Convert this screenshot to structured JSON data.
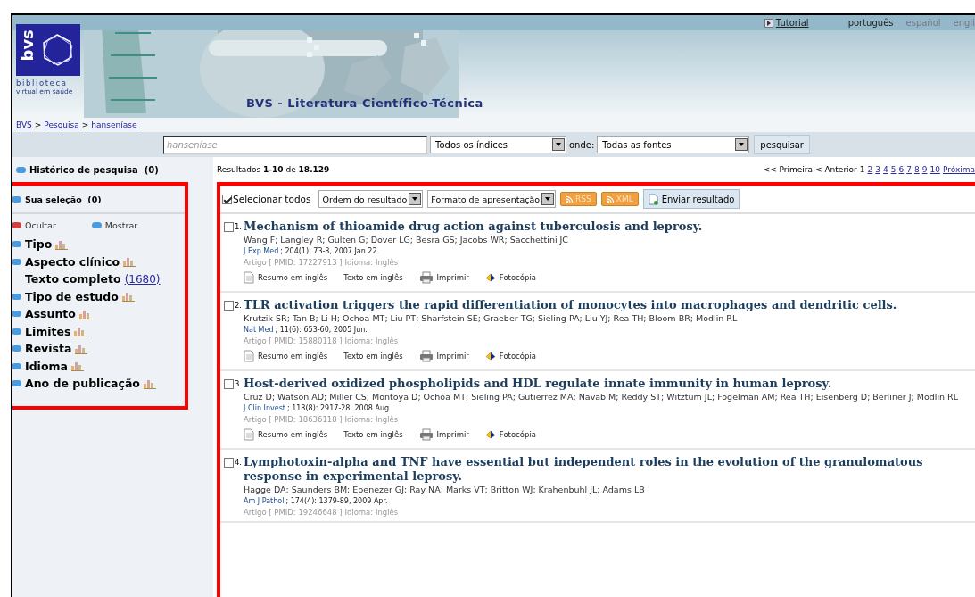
{
  "header": {
    "logo_mark": "bvs",
    "logo_lines": [
      "biblioteca",
      "virtual em saúde"
    ],
    "title": "BVS - Literatura Científico-Técnica",
    "tutorial": "Tutorial",
    "languages": [
      {
        "label": "português",
        "selected": true
      },
      {
        "label": "español",
        "selected": false
      },
      {
        "label": "engli",
        "selected": false
      }
    ]
  },
  "breadcrumb": {
    "separator": ">",
    "items": [
      "BVS",
      "Pesquisa",
      "hanseníase"
    ]
  },
  "search": {
    "placeholder": "hanseníase",
    "index_select": "Todos os índices",
    "where_label": "onde:",
    "source_select": "Todas as fontes",
    "button": "pesquisar"
  },
  "sidebar": {
    "history": {
      "label": "Histórico de pesquisa",
      "count": "(0)"
    },
    "selection": {
      "label": "Sua seleção",
      "count": "(0)"
    },
    "hide": "Ocultar",
    "show": "Mostrar",
    "filters": [
      {
        "kind": "expandable",
        "label": "Tipo"
      },
      {
        "kind": "expandable",
        "label": "Aspecto clínico"
      },
      {
        "kind": "count",
        "label": "Texto completo",
        "count": "(1680)"
      },
      {
        "kind": "expandable",
        "label": "Tipo de estudo"
      },
      {
        "kind": "expandable",
        "label": "Assunto"
      },
      {
        "kind": "expandable",
        "label": "Limites"
      },
      {
        "kind": "expandable",
        "label": "Revista"
      },
      {
        "kind": "expandable",
        "label": "Idioma"
      },
      {
        "kind": "expandable",
        "label": "Ano de publicação"
      }
    ]
  },
  "summary": "Resultados **1-10** de **18.129**",
  "pagination": {
    "first": "<< Primeira",
    "previous": "< Anterior",
    "next": "Próxima",
    "pages": [
      {
        "label": "1",
        "selected": true
      },
      {
        "label": "2",
        "selected": false
      },
      {
        "label": "3",
        "selected": false
      },
      {
        "label": "4",
        "selected": false
      },
      {
        "label": "5",
        "selected": false
      },
      {
        "label": "6",
        "selected": false
      },
      {
        "label": "7",
        "selected": false
      },
      {
        "label": "8",
        "selected": false
      },
      {
        "label": "9",
        "selected": false
      },
      {
        "label": "10",
        "selected": false
      }
    ]
  },
  "toolbar": {
    "select_all": {
      "label": "Selecionar todos",
      "checked": true
    },
    "order_select": "Ordem do resultado",
    "format_select": "Formato de apresentação",
    "feeds": [
      "RSS",
      "XML"
    ],
    "send": "Enviar resultado"
  },
  "results": [
    {
      "number": "1.",
      "checked": false,
      "title": "Mechanism of thioamide drug action against tuberculosis and leprosy.",
      "authors": "Wang F; Langley R; Gulten G; Dover LG; Besra GS; Jacobs WR; Sacchettini JC",
      "journal": "J Exp Med",
      "citation": "; 204(1): 73-8, 2007 Jan 22.",
      "meta": "Artigo [ PMID: 17227913 ] Idioma: Inglês",
      "actions": [
        {
          "kind": "abstract",
          "label": "Resumo em inglês"
        },
        {
          "kind": "text",
          "label": "Texto em inglês"
        },
        {
          "kind": "print",
          "label": "Imprimir"
        },
        {
          "kind": "photocopy",
          "label": "Fotocópia"
        }
      ]
    },
    {
      "number": "2.",
      "checked": false,
      "title": "TLR activation triggers the rapid differentiation of monocytes into macrophages and dendritic cells.",
      "authors": "Krutzik SR; Tan B; Li H; Ochoa MT; Liu PT; Sharfstein SE; Graeber TG; Sieling PA; Liu YJ; Rea TH; Bloom BR; Modlin RL",
      "journal": "Nat Med",
      "citation": "; 11(6): 653-60, 2005 Jun.",
      "meta": "Artigo [ PMID: 15880118 ] Idioma: Inglês",
      "actions": [
        {
          "kind": "abstract",
          "label": "Resumo em inglês"
        },
        {
          "kind": "text",
          "label": "Texto em inglês"
        },
        {
          "kind": "print",
          "label": "Imprimir"
        },
        {
          "kind": "photocopy",
          "label": "Fotocópia"
        }
      ]
    },
    {
      "number": "3.",
      "checked": false,
      "title": "Host-derived oxidized phospholipids and HDL regulate innate immunity in human leprosy.",
      "authors": "Cruz D; Watson AD; Miller CS; Montoya D; Ochoa MT; Sieling PA; Gutierrez MA; Navab M; Reddy ST; Witztum JL; Fogelman AM; Rea TH; Eisenberg D; Berliner J; Modlin RL",
      "journal": "J Clin Invest",
      "citation": "; 118(8): 2917-28, 2008 Aug.",
      "meta": "Artigo [ PMID: 18636118 ] Idioma: Inglês",
      "actions": [
        {
          "kind": "abstract",
          "label": "Resumo em inglês"
        },
        {
          "kind": "text",
          "label": "Texto em inglês"
        },
        {
          "kind": "print",
          "label": "Imprimir"
        },
        {
          "kind": "photocopy",
          "label": "Fotocópia"
        }
      ]
    },
    {
      "number": "4.",
      "checked": false,
      "title": "Lymphotoxin-alpha and TNF have essential but independent roles in the evolution of the granulomatous response in experimental leprosy.",
      "authors": "Hagge DA; Saunders BM; Ebenezer GJ; Ray NA; Marks VT; Britton WJ; Krahenbuhl JL; Adams LB",
      "journal": "Am J Pathol",
      "citation": "; 174(4): 1379-89, 2009 Apr.",
      "meta": "Artigo [ PMID: 19246648 ] Idioma: Inglês"
    }
  ]
}
